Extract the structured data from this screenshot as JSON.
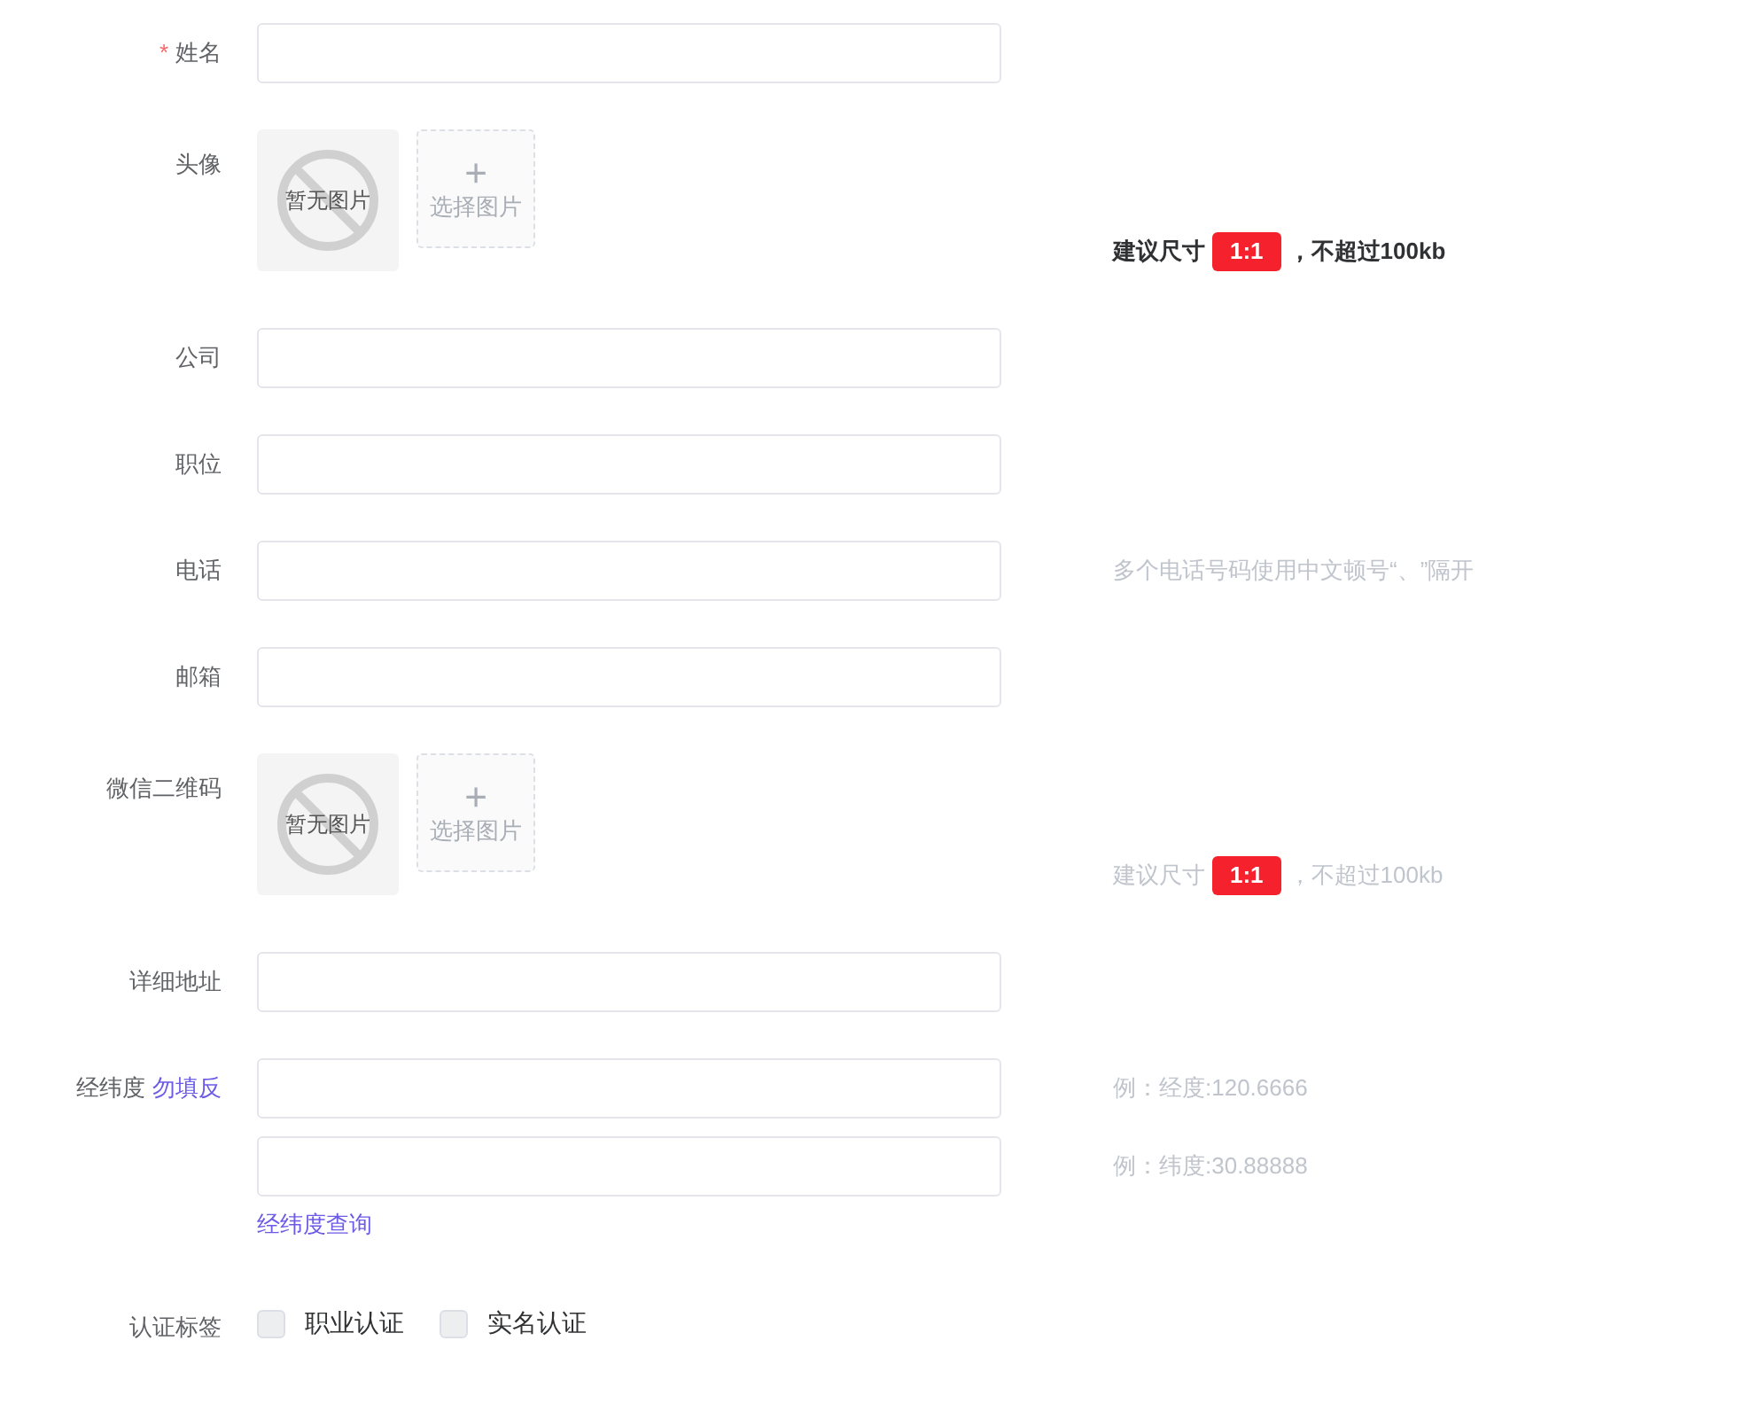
{
  "fields": [
    {
      "kind": "text",
      "label": "姓名",
      "required": true,
      "required_mark": "*"
    },
    {
      "kind": "image",
      "label": "头像",
      "empty_text": "暂无图片",
      "upload_glyph": "+",
      "upload_text": "选择图片",
      "hint": {
        "emphasized": true,
        "before": "建议尺寸",
        "badge": "1:1",
        "after": "，不超过100kb"
      }
    },
    {
      "kind": "text",
      "label": "公司"
    },
    {
      "kind": "text",
      "label": "职位"
    },
    {
      "kind": "text",
      "label": "电话",
      "hint": {
        "emphasized": false,
        "before": "多个电话号码使用中文顿号“、”隔开"
      }
    },
    {
      "kind": "text",
      "label": "邮箱"
    },
    {
      "kind": "image",
      "label": "微信二维码",
      "empty_text": "暂无图片",
      "upload_glyph": "+",
      "upload_text": "选择图片",
      "hint": {
        "emphasized": false,
        "before": "建议尺寸",
        "badge": "1:1",
        "after": "，不超过100kb"
      }
    },
    {
      "kind": "text",
      "label": "详细地址"
    },
    {
      "kind": "coords",
      "label": "经纬度",
      "label_link": "勿填反",
      "inputs": [
        {
          "hint": "例：经度:120.6666"
        },
        {
          "hint": "例：纬度:30.88888"
        }
      ],
      "link": "经纬度查询"
    },
    {
      "kind": "checks",
      "label": "认证标签",
      "options": [
        {
          "label": "职业认证",
          "checked": false
        },
        {
          "label": "实名认证",
          "checked": false
        }
      ]
    }
  ]
}
